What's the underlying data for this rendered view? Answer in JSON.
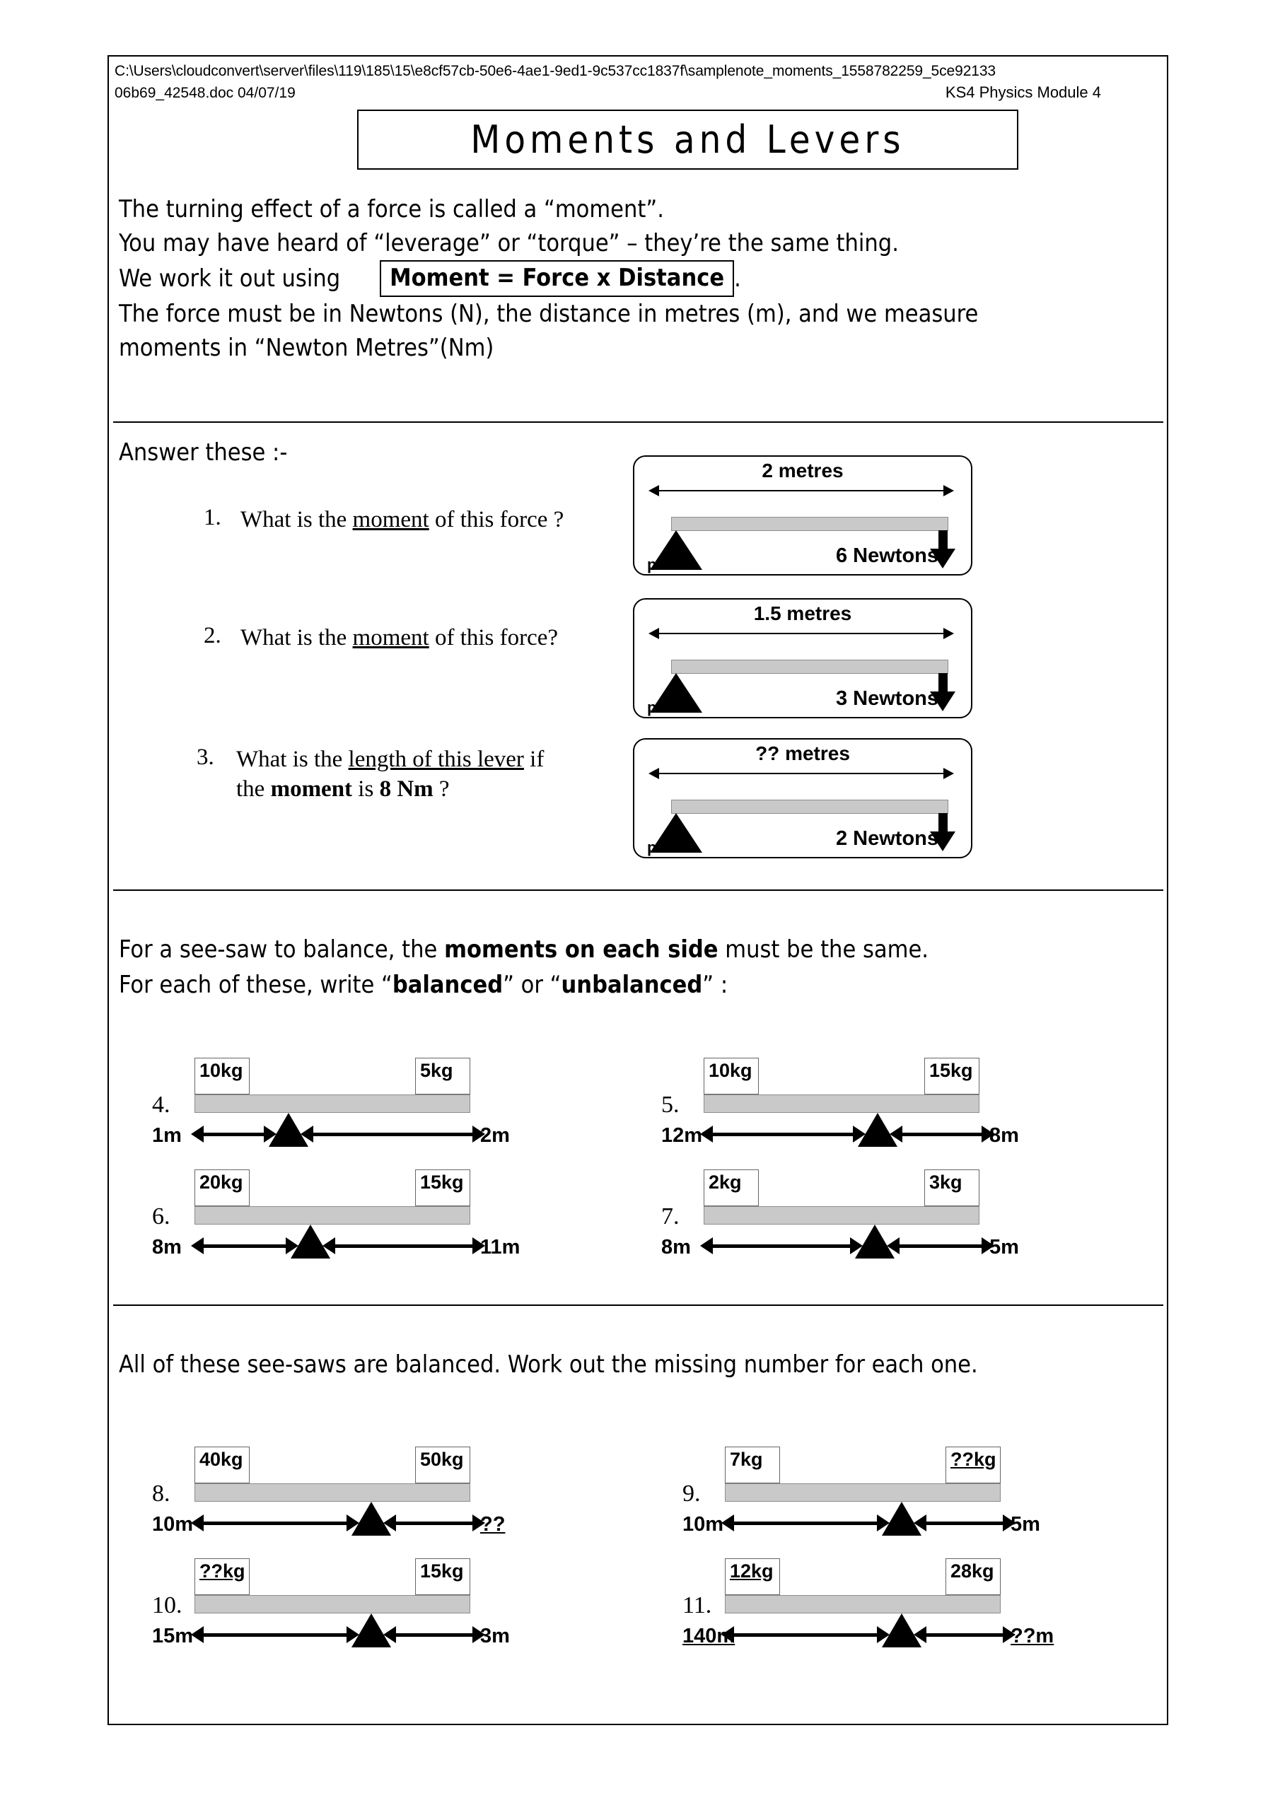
{
  "header": {
    "file_path": "C:\\Users\\cloudconvert\\server\\files\\119\\185\\15\\e8cf57cb-50e6-4ae1-9ed1-9c537cc1837f\\samplenote_moments_1558782259_5ce92133",
    "file_name_date": "06b69_42548.doc 04/07/19",
    "module": "KS4 Physics Module 4"
  },
  "title": "Moments and Levers",
  "intro": {
    "line1": "The turning effect of a force is called a “moment”.",
    "line2": "You may have heard of “leverage” or “torque” – they’re the same thing.",
    "line3_lead": "We work it out using",
    "formula": "Moment = Force x Distance",
    "line3_tail": ".",
    "line4": "The force must be in Newtons (N), the distance in metres (m), and we measure",
    "line5": "moments in “Newton Metres”(Nm)"
  },
  "section_a": {
    "heading": "Answer these :-",
    "questions": [
      {
        "number": "1.",
        "text_pre": "What is the ",
        "text_underlined": "moment",
        "text_post": " of this force ?",
        "text_line2": ""
      },
      {
        "number": "2.",
        "text_pre": "What is the ",
        "text_underlined": "moment",
        "text_post": " of this force?",
        "text_line2": ""
      },
      {
        "number": "3.",
        "text_pre": "What is the ",
        "text_underlined": "length of this lever",
        "text_post": " if",
        "text_line2_pre": "the ",
        "text_line2_bold": "moment",
        "text_line2_mid": " is ",
        "text_line2_bold2": "8 Nm",
        "text_line2_post": " ?"
      }
    ],
    "levers": [
      {
        "distance": "2 metres",
        "force": "6 Newtons",
        "pivot": "pivot"
      },
      {
        "distance": "1.5 metres",
        "force": "3 Newtons",
        "pivot": "pivot"
      },
      {
        "distance": "?? metres",
        "force": "2 Newtons",
        "pivot": "pivot"
      }
    ]
  },
  "section_b": {
    "line1_pre": "For a see-saw to balance, the ",
    "line1_bold": "moments on each side",
    "line1_post": " must be the same.",
    "line2_pre": "For each of these, write “",
    "line2_bold1": "balanced",
    "line2_mid": "” or “",
    "line2_bold2": "unbalanced",
    "line2_post": "” :",
    "seesaws": [
      {
        "number": "4.",
        "left_mass": "10kg",
        "right_mass": "5kg",
        "left_dist": "1m",
        "right_dist": "2m",
        "pivot_pct": 34,
        "left_mass_underlined": false,
        "right_mass_underlined": false,
        "left_dist_underlined": false,
        "right_dist_underlined": false
      },
      {
        "number": "5.",
        "left_mass": "10kg",
        "right_mass": "15kg",
        "left_dist": "12m",
        "right_dist": "8m",
        "pivot_pct": 63,
        "left_mass_underlined": false,
        "right_mass_underlined": false,
        "left_dist_underlined": false,
        "right_dist_underlined": false
      },
      {
        "number": "6.",
        "left_mass": "20kg",
        "right_mass": "15kg",
        "left_dist": "8m",
        "right_dist": "11m",
        "pivot_pct": 42,
        "left_mass_underlined": false,
        "right_mass_underlined": false,
        "left_dist_underlined": false,
        "right_dist_underlined": false
      },
      {
        "number": "7.",
        "left_mass": "2kg",
        "right_mass": "3kg",
        "left_dist": "8m",
        "right_dist": "5m",
        "pivot_pct": 62,
        "left_mass_underlined": false,
        "right_mass_underlined": false,
        "left_dist_underlined": false,
        "right_dist_underlined": false
      }
    ]
  },
  "section_c": {
    "line1": "All of these see-saws are balanced. Work out the missing number for each one.",
    "seesaws": [
      {
        "number": "8.",
        "left_mass": "40kg",
        "right_mass": "50kg",
        "left_dist": "10m",
        "right_dist": "??",
        "pivot_pct": 64,
        "left_mass_underlined": false,
        "right_mass_underlined": false,
        "left_dist_underlined": false,
        "right_dist_underlined": true
      },
      {
        "number": "9.",
        "left_mass": "7kg",
        "right_mass": "??kg",
        "left_dist": "10m",
        "right_dist": "5m",
        "pivot_pct": 64,
        "left_mass_underlined": false,
        "right_mass_underlined": true,
        "left_dist_underlined": false,
        "right_dist_underlined": false
      },
      {
        "number": "10.",
        "left_mass": "??kg",
        "right_mass": "15kg",
        "left_dist": "15m",
        "right_dist": "3m",
        "pivot_pct": 64,
        "left_mass_underlined": true,
        "right_mass_underlined": false,
        "left_dist_underlined": false,
        "right_dist_underlined": false
      },
      {
        "number": "11.",
        "left_mass": "12kg",
        "right_mass": "28kg",
        "left_dist": "140m",
        "right_dist": "??m",
        "pivot_pct": 64,
        "left_mass_underlined": true,
        "right_mass_underlined": false,
        "left_dist_underlined": true,
        "right_dist_underlined": false
      }
    ]
  },
  "colors": {
    "beam_fill": "#c9c9c9",
    "beam_stroke": "#8d8d8d",
    "ink": "#000000",
    "paper": "#ffffff"
  }
}
